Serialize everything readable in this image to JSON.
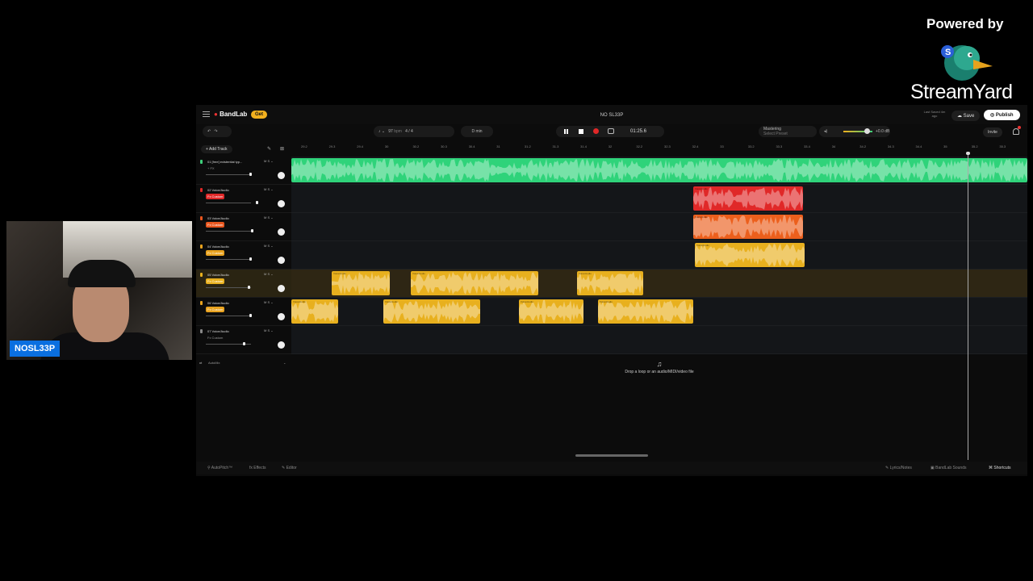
{
  "overlay": {
    "powered_by": "Powered by",
    "brand": "StreamYard",
    "logo_icon": "duck-logo-icon"
  },
  "webcam": {
    "name": "NOSL33P"
  },
  "daw": {
    "app_name": "BandLab",
    "get_label": "Get",
    "project_title": "NO SL33P",
    "last_saved": "Last Saved 4m ago",
    "save_label": "Save",
    "publish_label": "Publish",
    "invite_label": "Invite",
    "tempo": "97",
    "tempo_unit": "bpm",
    "time_signature": "4 / 4",
    "key": "D min",
    "time": "01:25.6",
    "mastering_title": "Mastering",
    "mastering_sub": "Select Preset",
    "volume": "+0.0 dB",
    "add_track": "+ Add Track",
    "automix": "AutoMix",
    "drop_text": "Drop a loop or an audio/MIDI/video file",
    "ruler_ticks": [
      "29.2",
      "29.3",
      "29.4",
      "30",
      "30.2",
      "30.3",
      "30.4",
      "31",
      "31.2",
      "31.3",
      "31.4",
      "32",
      "32.2",
      "32.3",
      "32.4",
      "33",
      "33.2",
      "33.3",
      "33.4",
      "34",
      "34.2",
      "34.3",
      "34.4",
      "35",
      "35.2",
      "35.3"
    ],
    "tracks": [
      {
        "name": "01 [free] existential typ...",
        "fx": "+ FX",
        "fx_color": "",
        "rec_color": "#3dcf7a"
      },
      {
        "name": "02 Voice/Audio",
        "fx": "Fx Custom",
        "fx_color": "#e02828",
        "rec_color": "#e02828"
      },
      {
        "name": "03 Voice/Audio",
        "fx": "Fx Custom",
        "fx_color": "#e8561e",
        "rec_color": "#e8561e"
      },
      {
        "name": "04 Voice/Audio",
        "fx": "Fx Custom",
        "fx_color": "#e8a21e",
        "rec_color": "#e8a21e"
      },
      {
        "name": "05 Voice/Audio",
        "fx": "Fx Custom",
        "fx_color": "#e8b01e",
        "rec_color": "#e8b01e"
      },
      {
        "name": "06 Voice/Audio",
        "fx": "Fx Custom",
        "fx_color": "#e8a21e",
        "rec_color": "#e8a21e"
      },
      {
        "name": "07 Voice/Audio",
        "fx": "Fx Custom",
        "fx_color": "",
        "rec_color": "#888888"
      }
    ],
    "bottom": {
      "autopitch": "AutoPitch™",
      "effects": "Effects",
      "editor": "Editor",
      "lyrics": "Lyrics/Notes",
      "sounds": "BandLab Sounds",
      "shortcuts": "Shortcuts"
    },
    "colors": {
      "green": "#2fd37a",
      "red": "#e02828",
      "orange": "#ec5f1c",
      "yellow": "#e8b01e"
    },
    "clip_label": "Voice/Audio"
  }
}
